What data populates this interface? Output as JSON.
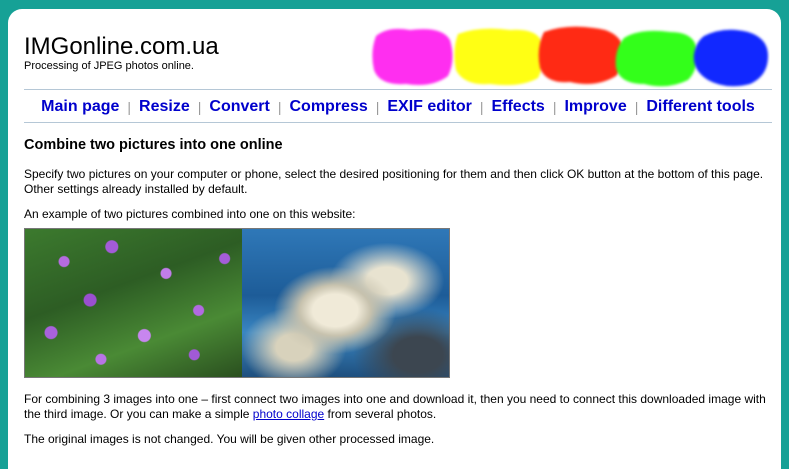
{
  "site": {
    "title": "IMGonline.com.ua",
    "subtitle": "Processing of JPEG photos online."
  },
  "color_blobs": [
    "#ff2ef0",
    "#ffff14",
    "#ff2a14",
    "#33ff1a",
    "#1128ff"
  ],
  "nav": {
    "items": [
      {
        "label": "Main page"
      },
      {
        "label": "Resize"
      },
      {
        "label": "Convert"
      },
      {
        "label": "Compress"
      },
      {
        "label": "EXIF editor"
      },
      {
        "label": "Effects"
      },
      {
        "label": "Improve"
      },
      {
        "label": "Different tools"
      }
    ],
    "separator": "|"
  },
  "main": {
    "heading": "Combine two pictures into one online",
    "intro": "Specify two pictures on your computer or phone, select the desired positioning for them and then click OK button at the bottom of this page. Other settings already installed by default.",
    "example_caption": "An example of two pictures combined into one on this website:",
    "combine3_before": "For combining 3 images into one – first connect two images into one and download it, then you need to connect this downloaded image with the third image. Or you can make a simple ",
    "combine3_link": "photo collage",
    "combine3_after": " from several photos.",
    "original_note": "The original images is not changed. You will be given other processed image."
  }
}
